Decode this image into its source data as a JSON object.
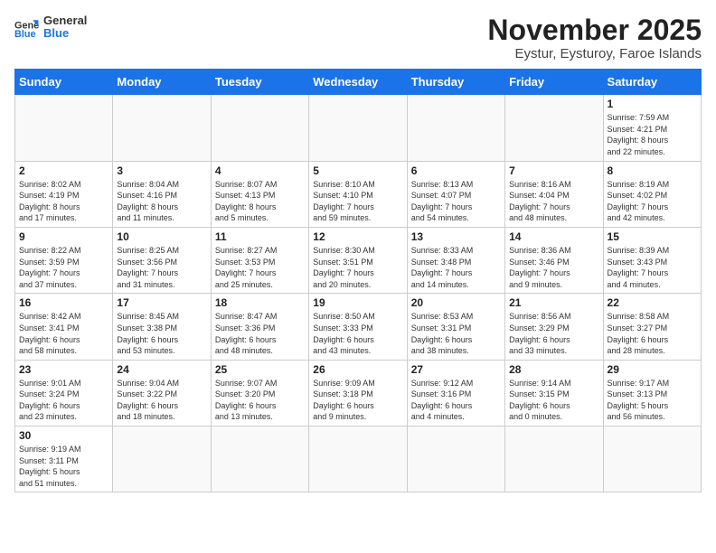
{
  "logo": {
    "general": "General",
    "blue": "Blue"
  },
  "title": "November 2025",
  "subtitle": "Eystur, Eysturoy, Faroe Islands",
  "weekdays": [
    "Sunday",
    "Monday",
    "Tuesday",
    "Wednesday",
    "Thursday",
    "Friday",
    "Saturday"
  ],
  "weeks": [
    [
      {
        "day": "",
        "info": ""
      },
      {
        "day": "",
        "info": ""
      },
      {
        "day": "",
        "info": ""
      },
      {
        "day": "",
        "info": ""
      },
      {
        "day": "",
        "info": ""
      },
      {
        "day": "",
        "info": ""
      },
      {
        "day": "1",
        "info": "Sunrise: 7:59 AM\nSunset: 4:21 PM\nDaylight: 8 hours\nand 22 minutes."
      }
    ],
    [
      {
        "day": "2",
        "info": "Sunrise: 8:02 AM\nSunset: 4:19 PM\nDaylight: 8 hours\nand 17 minutes."
      },
      {
        "day": "3",
        "info": "Sunrise: 8:04 AM\nSunset: 4:16 PM\nDaylight: 8 hours\nand 11 minutes."
      },
      {
        "day": "4",
        "info": "Sunrise: 8:07 AM\nSunset: 4:13 PM\nDaylight: 8 hours\nand 5 minutes."
      },
      {
        "day": "5",
        "info": "Sunrise: 8:10 AM\nSunset: 4:10 PM\nDaylight: 7 hours\nand 59 minutes."
      },
      {
        "day": "6",
        "info": "Sunrise: 8:13 AM\nSunset: 4:07 PM\nDaylight: 7 hours\nand 54 minutes."
      },
      {
        "day": "7",
        "info": "Sunrise: 8:16 AM\nSunset: 4:04 PM\nDaylight: 7 hours\nand 48 minutes."
      },
      {
        "day": "8",
        "info": "Sunrise: 8:19 AM\nSunset: 4:02 PM\nDaylight: 7 hours\nand 42 minutes."
      }
    ],
    [
      {
        "day": "9",
        "info": "Sunrise: 8:22 AM\nSunset: 3:59 PM\nDaylight: 7 hours\nand 37 minutes."
      },
      {
        "day": "10",
        "info": "Sunrise: 8:25 AM\nSunset: 3:56 PM\nDaylight: 7 hours\nand 31 minutes."
      },
      {
        "day": "11",
        "info": "Sunrise: 8:27 AM\nSunset: 3:53 PM\nDaylight: 7 hours\nand 25 minutes."
      },
      {
        "day": "12",
        "info": "Sunrise: 8:30 AM\nSunset: 3:51 PM\nDaylight: 7 hours\nand 20 minutes."
      },
      {
        "day": "13",
        "info": "Sunrise: 8:33 AM\nSunset: 3:48 PM\nDaylight: 7 hours\nand 14 minutes."
      },
      {
        "day": "14",
        "info": "Sunrise: 8:36 AM\nSunset: 3:46 PM\nDaylight: 7 hours\nand 9 minutes."
      },
      {
        "day": "15",
        "info": "Sunrise: 8:39 AM\nSunset: 3:43 PM\nDaylight: 7 hours\nand 4 minutes."
      }
    ],
    [
      {
        "day": "16",
        "info": "Sunrise: 8:42 AM\nSunset: 3:41 PM\nDaylight: 6 hours\nand 58 minutes."
      },
      {
        "day": "17",
        "info": "Sunrise: 8:45 AM\nSunset: 3:38 PM\nDaylight: 6 hours\nand 53 minutes."
      },
      {
        "day": "18",
        "info": "Sunrise: 8:47 AM\nSunset: 3:36 PM\nDaylight: 6 hours\nand 48 minutes."
      },
      {
        "day": "19",
        "info": "Sunrise: 8:50 AM\nSunset: 3:33 PM\nDaylight: 6 hours\nand 43 minutes."
      },
      {
        "day": "20",
        "info": "Sunrise: 8:53 AM\nSunset: 3:31 PM\nDaylight: 6 hours\nand 38 minutes."
      },
      {
        "day": "21",
        "info": "Sunrise: 8:56 AM\nSunset: 3:29 PM\nDaylight: 6 hours\nand 33 minutes."
      },
      {
        "day": "22",
        "info": "Sunrise: 8:58 AM\nSunset: 3:27 PM\nDaylight: 6 hours\nand 28 minutes."
      }
    ],
    [
      {
        "day": "23",
        "info": "Sunrise: 9:01 AM\nSunset: 3:24 PM\nDaylight: 6 hours\nand 23 minutes."
      },
      {
        "day": "24",
        "info": "Sunrise: 9:04 AM\nSunset: 3:22 PM\nDaylight: 6 hours\nand 18 minutes."
      },
      {
        "day": "25",
        "info": "Sunrise: 9:07 AM\nSunset: 3:20 PM\nDaylight: 6 hours\nand 13 minutes."
      },
      {
        "day": "26",
        "info": "Sunrise: 9:09 AM\nSunset: 3:18 PM\nDaylight: 6 hours\nand 9 minutes."
      },
      {
        "day": "27",
        "info": "Sunrise: 9:12 AM\nSunset: 3:16 PM\nDaylight: 6 hours\nand 4 minutes."
      },
      {
        "day": "28",
        "info": "Sunrise: 9:14 AM\nSunset: 3:15 PM\nDaylight: 6 hours\nand 0 minutes."
      },
      {
        "day": "29",
        "info": "Sunrise: 9:17 AM\nSunset: 3:13 PM\nDaylight: 5 hours\nand 56 minutes."
      }
    ],
    [
      {
        "day": "30",
        "info": "Sunrise: 9:19 AM\nSunset: 3:11 PM\nDaylight: 5 hours\nand 51 minutes."
      },
      {
        "day": "",
        "info": ""
      },
      {
        "day": "",
        "info": ""
      },
      {
        "day": "",
        "info": ""
      },
      {
        "day": "",
        "info": ""
      },
      {
        "day": "",
        "info": ""
      },
      {
        "day": "",
        "info": ""
      }
    ]
  ]
}
